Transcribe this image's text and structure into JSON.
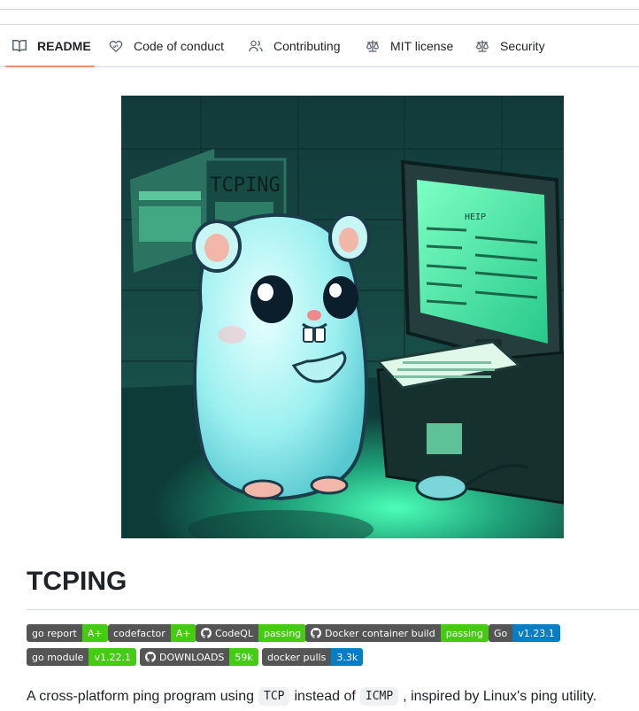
{
  "tabs": [
    {
      "label": "README",
      "icon": "book-icon",
      "active": true
    },
    {
      "label": "Code of conduct",
      "icon": "code-of-conduct-icon"
    },
    {
      "label": "Contributing",
      "icon": "people-icon"
    },
    {
      "label": "MIT license",
      "icon": "law-icon"
    },
    {
      "label": "Security",
      "icon": "law-icon"
    }
  ],
  "hero": {
    "sign_text": "TCPING",
    "screen_header": "HEIP"
  },
  "title": "TCPING",
  "badges": [
    {
      "label": "go report",
      "value": "A+",
      "color": "#4c1"
    },
    {
      "label": "codefactor",
      "value": "A+",
      "color": "#4c1"
    },
    {
      "label": "CodeQL",
      "value": "passing",
      "color": "#4c1",
      "icon": "github-icon"
    },
    {
      "label": "Docker container build",
      "value": "passing",
      "color": "#4c1",
      "icon": "github-icon"
    },
    {
      "label": "Go",
      "value": "v1.23.1",
      "color": "#007ec6"
    },
    {
      "label": "go module",
      "value": "v1.22.1",
      "color": "#4c1"
    },
    {
      "label": "DOWNLOADS",
      "value": "59k",
      "color": "#4c1",
      "icon": "github-icon"
    },
    {
      "label": "docker pulls",
      "value": "3.3k",
      "color": "#007ec6"
    }
  ],
  "description": {
    "before": "A cross-platform ping program using",
    "code1": "TCP",
    "middle": "instead of",
    "code2": "ICMP",
    "after": ", inspired by Linux's ping utility."
  }
}
